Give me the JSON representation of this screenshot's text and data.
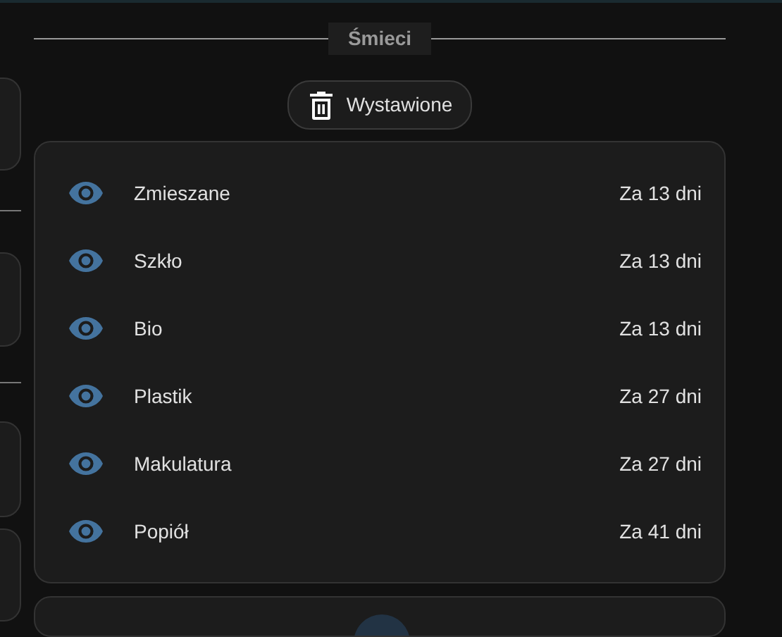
{
  "section": {
    "title": "Śmieci"
  },
  "button": {
    "label": "Wystawione"
  },
  "items": [
    {
      "name": "Zmieszane",
      "when": "Za 13 dni"
    },
    {
      "name": "Szkło",
      "when": "Za 13 dni"
    },
    {
      "name": "Bio",
      "when": "Za 13 dni"
    },
    {
      "name": "Plastik",
      "when": "Za 27 dni"
    },
    {
      "name": "Makulatura",
      "when": "Za 27 dni"
    },
    {
      "name": "Popiół",
      "when": "Za 41 dni"
    }
  ]
}
